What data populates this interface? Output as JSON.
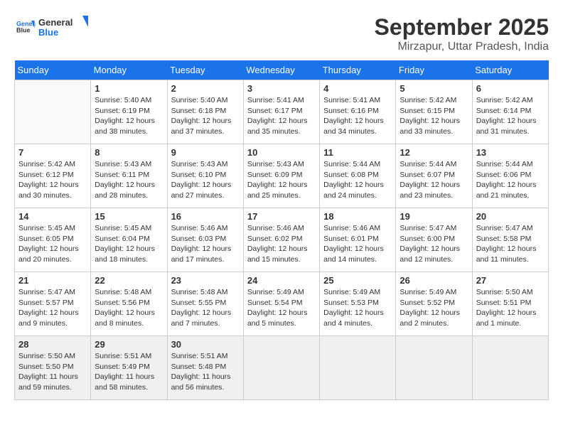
{
  "header": {
    "logo_line1": "General",
    "logo_line2": "Blue",
    "month": "September 2025",
    "location": "Mirzapur, Uttar Pradesh, India"
  },
  "days_of_week": [
    "Sunday",
    "Monday",
    "Tuesday",
    "Wednesday",
    "Thursday",
    "Friday",
    "Saturday"
  ],
  "weeks": [
    [
      {
        "day": null,
        "info": null
      },
      {
        "day": "1",
        "info": "Sunrise: 5:40 AM\nSunset: 6:19 PM\nDaylight: 12 hours\nand 38 minutes."
      },
      {
        "day": "2",
        "info": "Sunrise: 5:40 AM\nSunset: 6:18 PM\nDaylight: 12 hours\nand 37 minutes."
      },
      {
        "day": "3",
        "info": "Sunrise: 5:41 AM\nSunset: 6:17 PM\nDaylight: 12 hours\nand 35 minutes."
      },
      {
        "day": "4",
        "info": "Sunrise: 5:41 AM\nSunset: 6:16 PM\nDaylight: 12 hours\nand 34 minutes."
      },
      {
        "day": "5",
        "info": "Sunrise: 5:42 AM\nSunset: 6:15 PM\nDaylight: 12 hours\nand 33 minutes."
      },
      {
        "day": "6",
        "info": "Sunrise: 5:42 AM\nSunset: 6:14 PM\nDaylight: 12 hours\nand 31 minutes."
      }
    ],
    [
      {
        "day": "7",
        "info": "Sunrise: 5:42 AM\nSunset: 6:12 PM\nDaylight: 12 hours\nand 30 minutes."
      },
      {
        "day": "8",
        "info": "Sunrise: 5:43 AM\nSunset: 6:11 PM\nDaylight: 12 hours\nand 28 minutes."
      },
      {
        "day": "9",
        "info": "Sunrise: 5:43 AM\nSunset: 6:10 PM\nDaylight: 12 hours\nand 27 minutes."
      },
      {
        "day": "10",
        "info": "Sunrise: 5:43 AM\nSunset: 6:09 PM\nDaylight: 12 hours\nand 25 minutes."
      },
      {
        "day": "11",
        "info": "Sunrise: 5:44 AM\nSunset: 6:08 PM\nDaylight: 12 hours\nand 24 minutes."
      },
      {
        "day": "12",
        "info": "Sunrise: 5:44 AM\nSunset: 6:07 PM\nDaylight: 12 hours\nand 23 minutes."
      },
      {
        "day": "13",
        "info": "Sunrise: 5:44 AM\nSunset: 6:06 PM\nDaylight: 12 hours\nand 21 minutes."
      }
    ],
    [
      {
        "day": "14",
        "info": "Sunrise: 5:45 AM\nSunset: 6:05 PM\nDaylight: 12 hours\nand 20 minutes."
      },
      {
        "day": "15",
        "info": "Sunrise: 5:45 AM\nSunset: 6:04 PM\nDaylight: 12 hours\nand 18 minutes."
      },
      {
        "day": "16",
        "info": "Sunrise: 5:46 AM\nSunset: 6:03 PM\nDaylight: 12 hours\nand 17 minutes."
      },
      {
        "day": "17",
        "info": "Sunrise: 5:46 AM\nSunset: 6:02 PM\nDaylight: 12 hours\nand 15 minutes."
      },
      {
        "day": "18",
        "info": "Sunrise: 5:46 AM\nSunset: 6:01 PM\nDaylight: 12 hours\nand 14 minutes."
      },
      {
        "day": "19",
        "info": "Sunrise: 5:47 AM\nSunset: 6:00 PM\nDaylight: 12 hours\nand 12 minutes."
      },
      {
        "day": "20",
        "info": "Sunrise: 5:47 AM\nSunset: 5:58 PM\nDaylight: 12 hours\nand 11 minutes."
      }
    ],
    [
      {
        "day": "21",
        "info": "Sunrise: 5:47 AM\nSunset: 5:57 PM\nDaylight: 12 hours\nand 9 minutes."
      },
      {
        "day": "22",
        "info": "Sunrise: 5:48 AM\nSunset: 5:56 PM\nDaylight: 12 hours\nand 8 minutes."
      },
      {
        "day": "23",
        "info": "Sunrise: 5:48 AM\nSunset: 5:55 PM\nDaylight: 12 hours\nand 7 minutes."
      },
      {
        "day": "24",
        "info": "Sunrise: 5:49 AM\nSunset: 5:54 PM\nDaylight: 12 hours\nand 5 minutes."
      },
      {
        "day": "25",
        "info": "Sunrise: 5:49 AM\nSunset: 5:53 PM\nDaylight: 12 hours\nand 4 minutes."
      },
      {
        "day": "26",
        "info": "Sunrise: 5:49 AM\nSunset: 5:52 PM\nDaylight: 12 hours\nand 2 minutes."
      },
      {
        "day": "27",
        "info": "Sunrise: 5:50 AM\nSunset: 5:51 PM\nDaylight: 12 hours\nand 1 minute."
      }
    ],
    [
      {
        "day": "28",
        "info": "Sunrise: 5:50 AM\nSunset: 5:50 PM\nDaylight: 11 hours\nand 59 minutes."
      },
      {
        "day": "29",
        "info": "Sunrise: 5:51 AM\nSunset: 5:49 PM\nDaylight: 11 hours\nand 58 minutes."
      },
      {
        "day": "30",
        "info": "Sunrise: 5:51 AM\nSunset: 5:48 PM\nDaylight: 11 hours\nand 56 minutes."
      },
      {
        "day": null,
        "info": null
      },
      {
        "day": null,
        "info": null
      },
      {
        "day": null,
        "info": null
      },
      {
        "day": null,
        "info": null
      }
    ]
  ]
}
